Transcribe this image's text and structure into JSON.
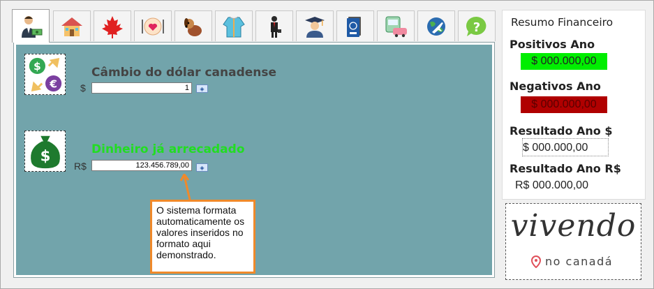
{
  "tabs": [
    {
      "icon": "businessman-money-icon"
    },
    {
      "icon": "house-icon"
    },
    {
      "icon": "maple-leaf-icon"
    },
    {
      "icon": "food-plate-icon"
    },
    {
      "icon": "dog-icon"
    },
    {
      "icon": "winter-coat-icon"
    },
    {
      "icon": "suit-person-icon"
    },
    {
      "icon": "graduate-icon"
    },
    {
      "icon": "passport-icon"
    },
    {
      "icon": "transport-icon"
    },
    {
      "icon": "globe-plane-icon"
    },
    {
      "icon": "help-icon"
    }
  ],
  "exchange": {
    "title": "Câmbio do dólar canadense",
    "currency": "$",
    "value": "1",
    "title_color": "#444444"
  },
  "raised": {
    "title": "Dinheiro já arrecadado",
    "currency": "R$",
    "value": "123.456.789,00",
    "title_color": "#22dd22"
  },
  "callout": {
    "text": "O sistema formata automaticamente os valores inseridos no formato aqui demonstrado."
  },
  "summary": {
    "title": "Resumo Financeiro",
    "positive_label": "Positivos Ano",
    "positive_value": "$ 000.000,00",
    "negative_label": "Negativos Ano",
    "negative_value": "$ 000.000,00",
    "result_cad_label": "Resultado Ano $",
    "result_cad_value": "$ 000.000,00",
    "result_brl_label": "Resultado Ano R$",
    "result_brl_value": "R$ 000.000,00",
    "positive_color": "#00ee00",
    "negative_color": "#b00000"
  },
  "logo": {
    "word": "vivendo",
    "sub": "no canadá"
  }
}
